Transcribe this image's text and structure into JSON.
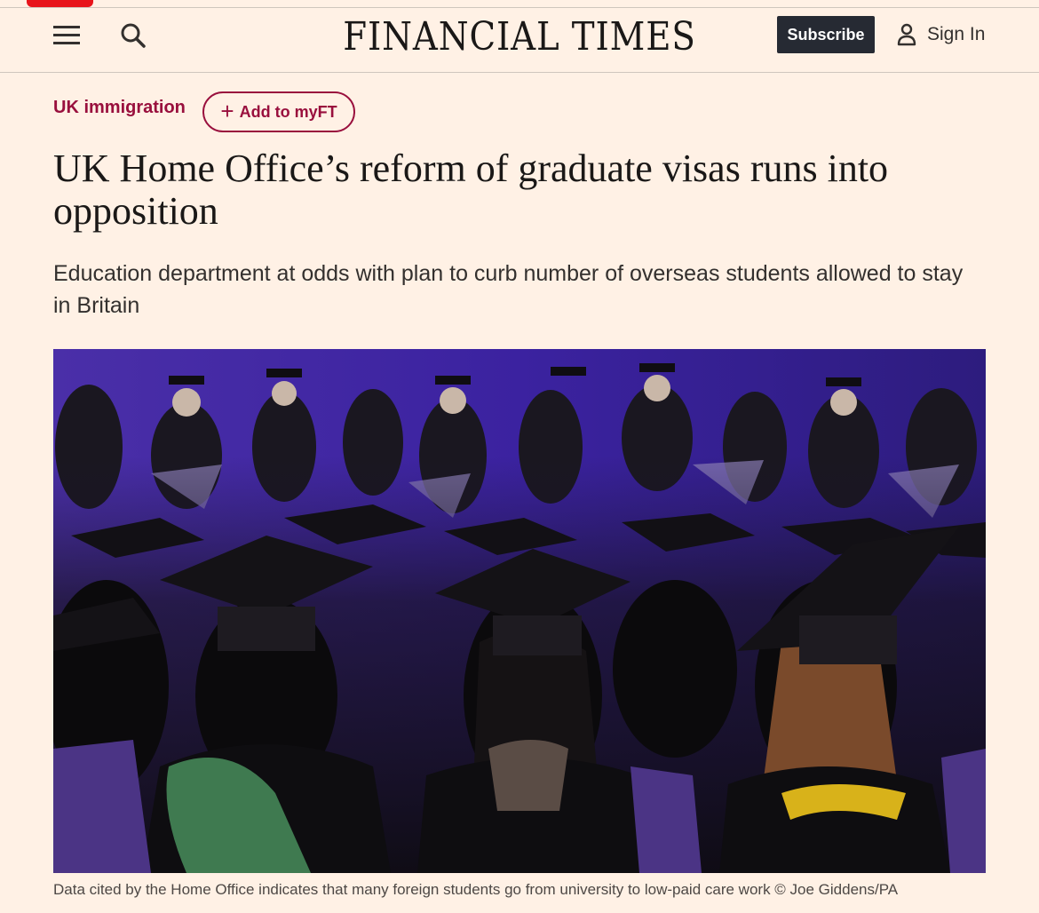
{
  "header": {
    "logo": "FINANCIAL TIMES",
    "subscribe_label": "Subscribe",
    "signin_label": "Sign In",
    "icons": {
      "menu": "hamburger-menu-icon",
      "search": "search-icon",
      "account": "user-icon"
    }
  },
  "article": {
    "topic": "UK immigration",
    "myft_label": "Add to myFT",
    "headline": "UK Home Office’s reform of graduate visas runs into opposition",
    "standfirst": "Education department at odds with plan to curb number of overseas students allowed to stay in Britain",
    "image": {
      "caption": "Data cited by the Home Office indicates that many foreign students go from university to low-paid care work © Joe Giddens/PA"
    }
  },
  "colors": {
    "background": "#fff1e5",
    "claret": "#990f3d",
    "subscribe_bg": "#262a33",
    "ft_red_tab": "#e8141b"
  }
}
